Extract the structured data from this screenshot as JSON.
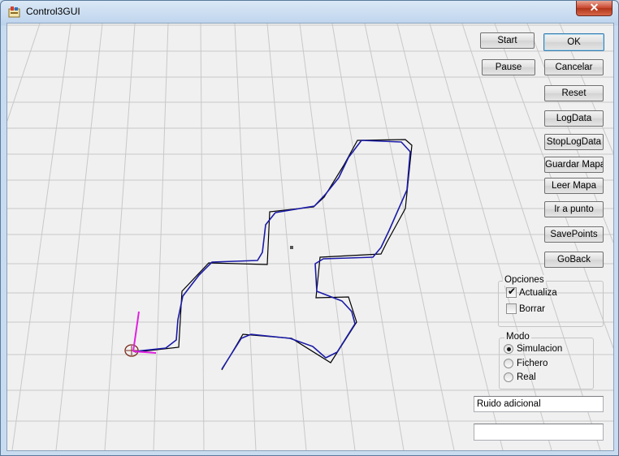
{
  "window": {
    "title": "Control3GUI",
    "close_symbol": "✕",
    "app_icon": "app-window-icon"
  },
  "buttons_left": {
    "start": "Start",
    "pause": "Pause"
  },
  "buttons_right": {
    "ok": "OK",
    "cancel": "Cancelar",
    "reset": "Reset",
    "logdata": "LogData",
    "stoplogdata": "StopLogData",
    "guardar_mapa": "Guardar Mapa",
    "leer_mapa": "Leer Mapa",
    "ir_a_punto": "Ir a punto",
    "savepoints": "SavePoints",
    "goback": "GoBack"
  },
  "opciones": {
    "legend": "Opciones",
    "actualiza": {
      "label": "Actualiza",
      "checked": true
    },
    "borrar": {
      "label": "Borrar",
      "checked": false
    }
  },
  "modo": {
    "legend": "Modo",
    "options": [
      "Simulacion",
      "Fichero",
      "Real"
    ],
    "selected": "Simulacion"
  },
  "fields": {
    "ruido_value": "Ruido adicional",
    "second_value": ""
  },
  "colors": {
    "planned_path": "#000000",
    "robot_path": "#1a1aa8",
    "robot_axis": "#e020e0",
    "grid": "#c8c8c8"
  }
}
